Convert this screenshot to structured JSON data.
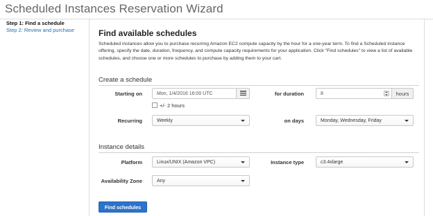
{
  "wizard": {
    "title": "Scheduled Instances Reservation Wizard"
  },
  "steps": [
    {
      "label": "Step 1: Find a schedule",
      "active": true
    },
    {
      "label": "Step 2: Review and purchase",
      "active": false
    }
  ],
  "main": {
    "heading": "Find available schedules",
    "description": "Scheduled instances allow you to purchase recurring Amazon EC2 compute capacity by the hour for a one-year term. To find a Scheduled instance offering, specify the date, duration, frequency, and compute capacity requirements for your application. Click \"Find schedules\" to view a list of available schedules, and choose one or more schedules to purchase by adding them to your cart."
  },
  "create_schedule": {
    "title": "Create a schedule",
    "starting_on": {
      "label": "Starting on",
      "value": "Mon, 1/4/2016 16:00 UTC",
      "calendar_icon": "calendar-icon"
    },
    "tolerance": {
      "label": "+/- 2 hours",
      "checked": false
    },
    "duration": {
      "label": "for duration",
      "value": "8",
      "unit": "hours"
    },
    "recurring": {
      "label": "Recurring",
      "value": "Weekly"
    },
    "on_days": {
      "label": "on days",
      "value": "Monday, Wednesday, Friday"
    }
  },
  "instance_details": {
    "title": "Instance details",
    "platform": {
      "label": "Platform",
      "value": "Linux/UNIX (Amazon VPC)"
    },
    "instance_type": {
      "label": "Instance type",
      "value": "c3.4xlarge"
    },
    "availability_zone": {
      "label": "Availability Zone",
      "value": "Any"
    }
  },
  "actions": {
    "find_label": "Find schedules"
  },
  "colors": {
    "primary_button": "#2d73c9",
    "link": "#1f6fb5"
  }
}
